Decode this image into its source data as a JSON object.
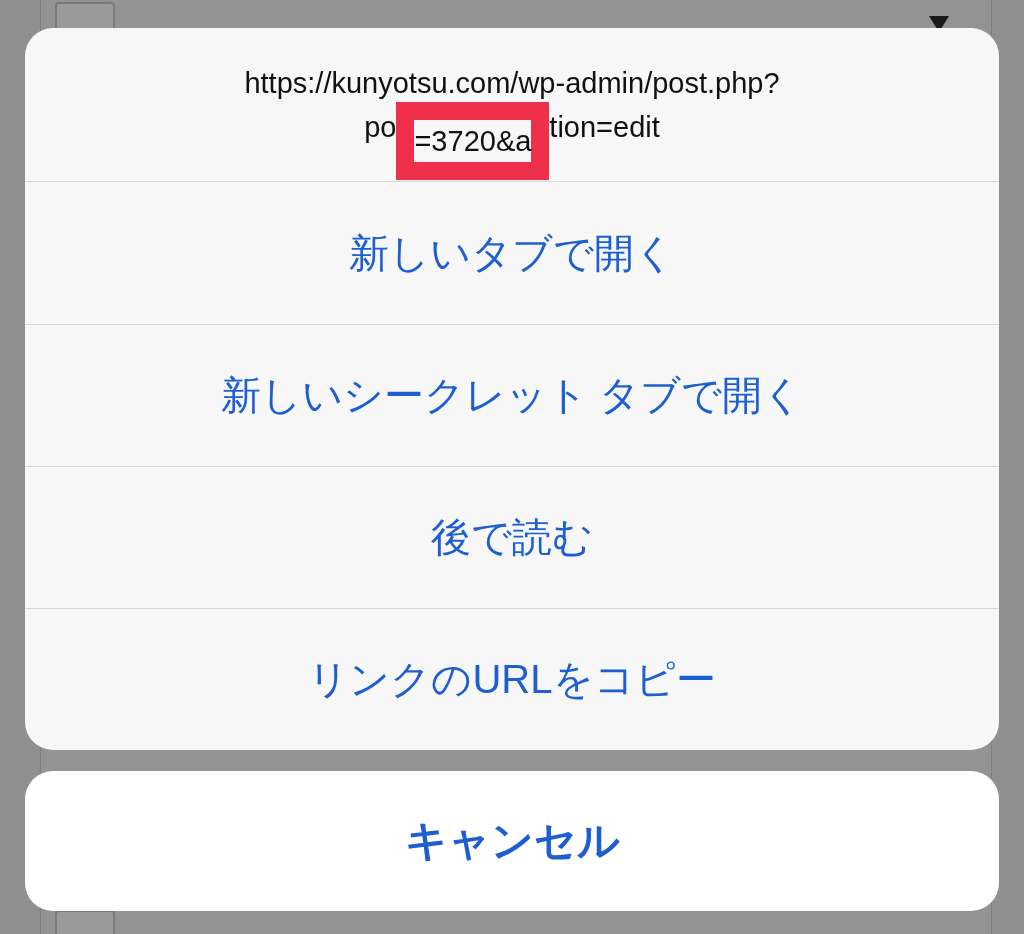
{
  "background_page": {
    "checkboxes": [
      {
        "checked": false
      },
      {
        "checked": false
      }
    ]
  },
  "action_sheet": {
    "url": {
      "line_1": "https://kunyotsu.com/wp-admin/post.php?",
      "line_2": {
        "before": "po",
        "highlight": "=3720&a",
        "after": "tion=edit"
      }
    },
    "actions": [
      "新しいタブで開く",
      "新しいシークレット タブで開く",
      "後で読む",
      "リンクのURLをコピー"
    ],
    "cancel": "キャンセル"
  }
}
